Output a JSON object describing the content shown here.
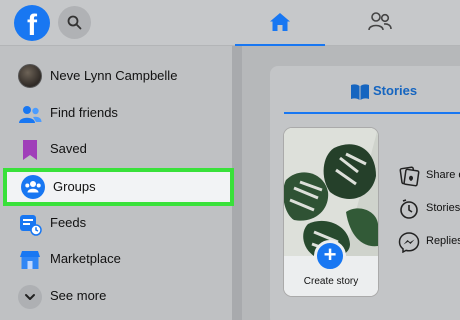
{
  "topbar": {
    "logo_letter": "f",
    "icons": [
      "facebook-logo",
      "search-icon",
      "home-icon",
      "friends-icon"
    ]
  },
  "sidebar": {
    "items": [
      {
        "label": "Neve Lynn Campbelle",
        "icon": "avatar"
      },
      {
        "label": "Find friends",
        "icon": "friends-icon"
      },
      {
        "label": "Saved",
        "icon": "bookmark-icon"
      },
      {
        "label": "Groups",
        "icon": "groups-icon",
        "highlighted": true
      },
      {
        "label": "Feeds",
        "icon": "feeds-icon"
      },
      {
        "label": "Marketplace",
        "icon": "marketplace-icon"
      },
      {
        "label": "See more",
        "icon": "chevron-down-icon"
      }
    ]
  },
  "main": {
    "stories_tab": "Stories",
    "create_story": "Create story",
    "plus": "+",
    "options": [
      {
        "label": "Share e",
        "icon": "share-photo-icon"
      },
      {
        "label": "Stories",
        "icon": "clock-icon"
      },
      {
        "label": "Replies",
        "icon": "messenger-icon"
      }
    ]
  },
  "colors": {
    "accent": "#1877f2",
    "highlight_border": "#39e13a"
  }
}
